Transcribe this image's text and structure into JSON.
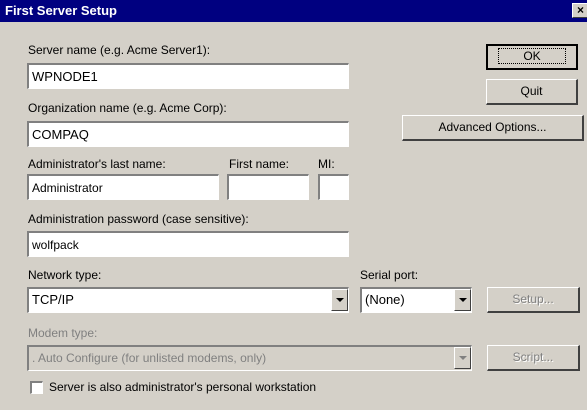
{
  "window": {
    "title": "First Server Setup",
    "close_glyph": "×"
  },
  "form": {
    "server_name": {
      "label": "Server name (e.g. Acme Server1):",
      "value": "WPNODE1"
    },
    "organization_name": {
      "label": "Organization name (e.g. Acme Corp):",
      "value": "COMPAQ"
    },
    "admin_last_name": {
      "label": "Administrator's last name:",
      "value": "Administrator"
    },
    "first_name": {
      "label": "First name:",
      "value": ""
    },
    "mi": {
      "label": "MI:",
      "value": ""
    },
    "password": {
      "label": "Administration password (case sensitive):",
      "value": "wolfpack"
    },
    "network_type": {
      "label": "Network type:",
      "value": "TCP/IP"
    },
    "serial_port": {
      "label": "Serial port:",
      "value": "(None)"
    },
    "modem_type": {
      "label": "Modem type:",
      "value": ". Auto Configure (for unlisted modems, only)"
    },
    "checkbox": {
      "label": "Server is also administrator's personal workstation",
      "checked": false
    }
  },
  "buttons": {
    "ok": "OK",
    "quit": "Quit",
    "advanced": "Advanced Options...",
    "setup": "Setup...",
    "script": "Script..."
  },
  "colors": {
    "titlebar": "#000080",
    "face": "#d4d0c8",
    "disabled_text": "#808080"
  }
}
